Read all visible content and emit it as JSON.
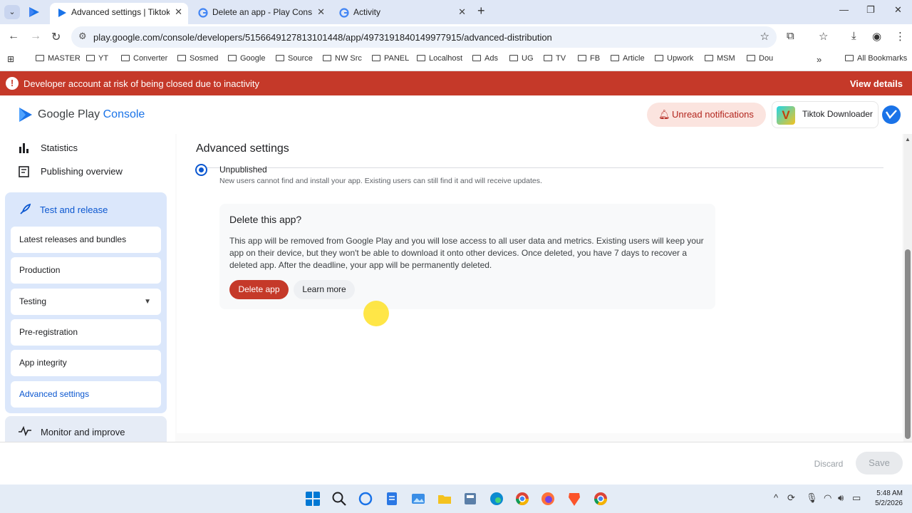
{
  "browser": {
    "tabs": [
      {
        "title": "Advanced settings | Tiktok Dow"
      },
      {
        "title": "Delete an app - Play Console H"
      },
      {
        "title": "Activity"
      }
    ],
    "url": "play.google.com/console/developers/5156649127813101448/app/4973191840149977915/advanced-distribution",
    "bookmarks": [
      "MASTER",
      "YT",
      "Converter",
      "Sosmed",
      "Google",
      "Source",
      "NW Src",
      "PANEL",
      "Localhost",
      "Ads",
      "UG",
      "TV",
      "FB",
      "Article",
      "Upwork",
      "MSM",
      "Dou"
    ],
    "all_bookmarks": "All Bookmarks",
    "more_bookmarks": "»"
  },
  "alert": {
    "message": "Developer account at risk of being closed due to inactivity",
    "action": "View details",
    "color": "#c53929"
  },
  "header": {
    "logo_text_1": "Google Play",
    "logo_text_2": "Console",
    "notifications": "Unread notifications",
    "app_letter": "V",
    "app_name": "Tiktok Downloader"
  },
  "sidebar": {
    "statistics": "Statistics",
    "publishing_overview": "Publishing overview",
    "test_and_release": "Test and release",
    "items": [
      {
        "label": "Latest releases and bundles"
      },
      {
        "label": "Production"
      },
      {
        "label": "Testing"
      },
      {
        "label": "Pre-registration"
      },
      {
        "label": "App integrity"
      },
      {
        "label": "Advanced settings"
      }
    ],
    "monitor": "Monitor and improve"
  },
  "main": {
    "title": "Advanced settings",
    "unpublished_label": "Unpublished",
    "unpublished_desc": "New users cannot find and install your app. Existing users can still find it and will receive updates.",
    "delete_title": "Delete this app?",
    "delete_text": "This app will be removed from Google Play and you will lose access to all user data and metrics. Existing users will keep your app on their device, but they won't be able to download it onto other devices. Once deleted, you have 7 days to recover a deleted app. After the deadline, your app will be permanently deleted.",
    "delete_button": "Delete app",
    "learn_more": "Learn more"
  },
  "footer": {
    "discard": "Discard",
    "save": "Save"
  },
  "taskbar": {
    "time": "5:48 AM",
    "date": "5/2/2026"
  }
}
